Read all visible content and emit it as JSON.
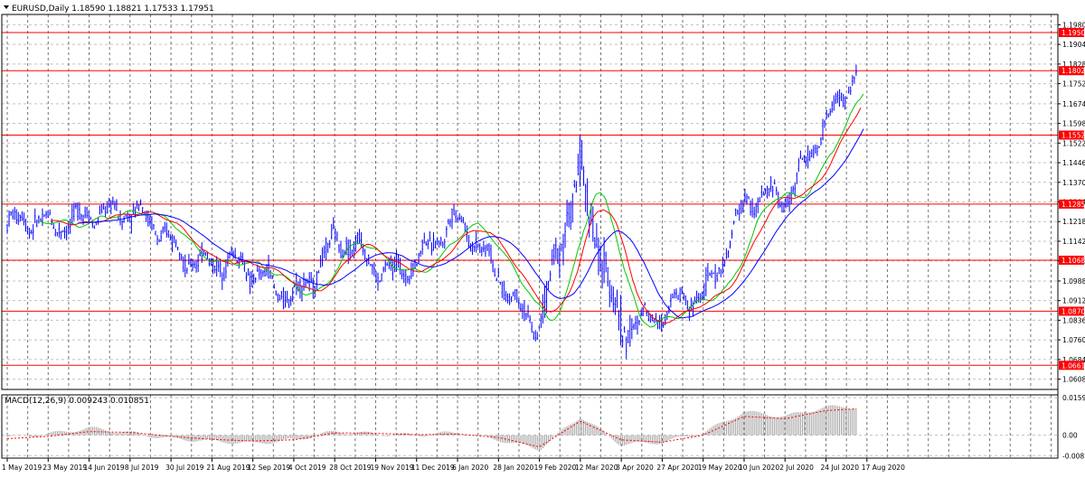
{
  "window": {
    "header": "EURUSD,Daily  1.18590 1.18821 1.17533 1.17951"
  },
  "colors": {
    "background": "#ffffff",
    "frame": "#000000",
    "grid": "#c0c0c0",
    "candles": "#0000ff",
    "ma_fast": "#00c800",
    "ma_mid": "#ff0000",
    "ma_slow": "#0000ff",
    "level_line": "#ff0000",
    "level_label_bg": "#ff0000",
    "level_label_text": "#ffffff",
    "macd_hist": "#a0a0a0",
    "macd_signal": "#ff0000"
  },
  "chart_data": [
    {
      "type": "line",
      "subtype": "candlestick-with-moving-averages",
      "symbol": "EURUSD",
      "timeframe": "Daily",
      "ohlc_last": {
        "open": 1.1859,
        "high": 1.18821,
        "low": 1.17533,
        "close": 1.17951
      },
      "ylim": [
        1.0568,
        1.202
      ],
      "y_ticks": [
        "1.19800",
        "1.19040",
        "1.18280",
        "1.17520",
        "1.16740",
        "1.15980",
        "1.15220",
        "1.14460",
        "1.13700",
        "1.12940",
        "1.12180",
        "1.11420",
        "1.10660",
        "1.09880",
        "1.09120",
        "1.08360",
        "1.07600",
        "1.06840",
        "1.06080"
      ],
      "x_ticks": [
        "1 May 2019",
        "23 May 2019",
        "14 Jun 2019",
        "8 Jul 2019",
        "30 Jul 2019",
        "21 Aug 2019",
        "12 Sep 2019",
        "4 Oct 2019",
        "28 Oct 2019",
        "19 Nov 2019",
        "11 Dec 2019",
        "6 Jan 2020",
        "28 Jan 2020",
        "19 Feb 2020",
        "12 Mar 2020",
        "3 Apr 2020",
        "27 Apr 2020",
        "19 May 2020",
        "10 Jun 2020",
        "2 Jul 2020",
        "24 Jul 2020",
        "17 Aug 2020"
      ],
      "horizontal_levels": [
        "1.19500",
        "1.18023",
        "1.15529",
        "1.12857",
        "1.10685",
        "1.08709",
        "1.06614"
      ],
      "price_path": [
        [
          "1 May 2019",
          1.12
        ],
        [
          "23 May 2019",
          1.117
        ],
        [
          "14 Jun 2019",
          1.13
        ],
        [
          "8 Jul 2019",
          1.122
        ],
        [
          "30 Jul 2019",
          1.115
        ],
        [
          "21 Aug 2019",
          1.108
        ],
        [
          "12 Sep 2019",
          1.098
        ],
        [
          "4 Oct 2019",
          1.097
        ],
        [
          "28 Oct 2019",
          1.112
        ],
        [
          "19 Nov 2019",
          1.103
        ],
        [
          "11 Dec 2019",
          1.11
        ],
        [
          "6 Jan 2020",
          1.118
        ],
        [
          "28 Jan 2020",
          1.105
        ],
        [
          "19 Feb 2020",
          1.08
        ],
        [
          "12 Mar 2020",
          1.138
        ],
        [
          "3 Apr 2020",
          1.085
        ],
        [
          "27 Apr 2020",
          1.082
        ],
        [
          "19 May 2020",
          1.095
        ],
        [
          "10 Jun 2020",
          1.13
        ],
        [
          "2 Jul 2020",
          1.126
        ],
        [
          "24 Jul 2020",
          1.165
        ],
        [
          "17 Aug 2020",
          1.185
        ]
      ]
    },
    {
      "type": "bar",
      "subtype": "macd",
      "label": "MACD(12,26,9) 0.009243 0.010851",
      "ylim": [
        -0.0098,
        0.0172
      ],
      "y_ticks": [
        "0.015993",
        "0.00",
        "-0.008746"
      ],
      "histogram": [
        [
          "1 May 2019",
          -0.001
        ],
        [
          "23 May 2019",
          0.0005
        ],
        [
          "14 Jun 2019",
          0.003
        ],
        [
          "8 Jul 2019",
          0.001
        ],
        [
          "30 Jul 2019",
          -0.0015
        ],
        [
          "21 Aug 2019",
          -0.0025
        ],
        [
          "12 Sep 2019",
          -0.0035
        ],
        [
          "4 Oct 2019",
          -0.002
        ],
        [
          "28 Oct 2019",
          0.0015
        ],
        [
          "19 Nov 2019",
          0.0005
        ],
        [
          "11 Dec 2019",
          0.0
        ],
        [
          "6 Jan 2020",
          0.0012
        ],
        [
          "28 Jan 2020",
          -0.002
        ],
        [
          "19 Feb 2020",
          -0.006
        ],
        [
          "12 Mar 2020",
          0.008
        ],
        [
          "3 Apr 2020",
          -0.004
        ],
        [
          "27 Apr 2020",
          -0.003
        ],
        [
          "19 May 2020",
          0.001
        ],
        [
          "10 Jun 2020",
          0.01
        ],
        [
          "2 Jul 2020",
          0.008
        ],
        [
          "24 Jul 2020",
          0.012
        ],
        [
          "17 Aug 2020",
          0.012
        ]
      ],
      "signal": [
        [
          "1 May 2019",
          -0.0015
        ],
        [
          "23 May 2019",
          -0.0005
        ],
        [
          "14 Jun 2019",
          0.0015
        ],
        [
          "8 Jul 2019",
          0.0012
        ],
        [
          "30 Jul 2019",
          -0.0005
        ],
        [
          "21 Aug 2019",
          -0.0018
        ],
        [
          "12 Sep 2019",
          -0.0025
        ],
        [
          "4 Oct 2019",
          -0.002
        ],
        [
          "28 Oct 2019",
          0.001
        ],
        [
          "19 Nov 2019",
          0.0008
        ],
        [
          "11 Dec 2019",
          0.0002
        ],
        [
          "6 Jan 2020",
          0.0005
        ],
        [
          "28 Jan 2020",
          -0.001
        ],
        [
          "19 Feb 2020",
          -0.005
        ],
        [
          "12 Mar 2020",
          0.006
        ],
        [
          "3 Apr 2020",
          -0.002
        ],
        [
          "27 Apr 2020",
          -0.003
        ],
        [
          "19 May 2020",
          0.0
        ],
        [
          "10 Jun 2020",
          0.008
        ],
        [
          "2 Jul 2020",
          0.007
        ],
        [
          "24 Jul 2020",
          0.0105
        ],
        [
          "17 Aug 2020",
          0.0115
        ]
      ]
    }
  ]
}
